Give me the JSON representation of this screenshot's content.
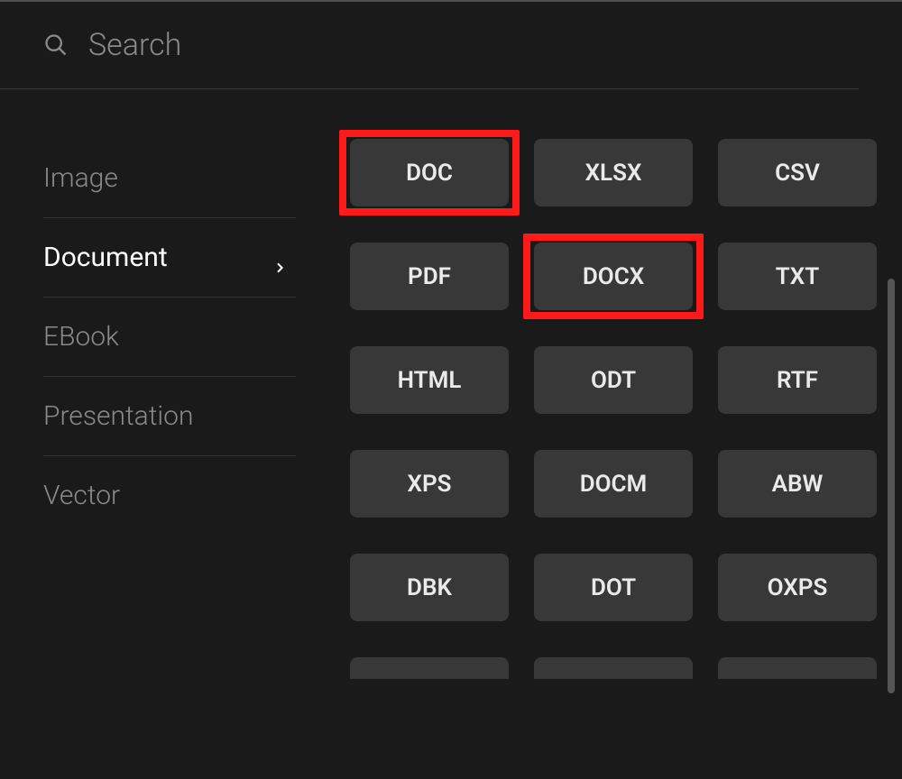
{
  "search": {
    "placeholder": "Search"
  },
  "sidebar": {
    "items": [
      {
        "label": "Image",
        "active": false
      },
      {
        "label": "Document",
        "active": true
      },
      {
        "label": "EBook",
        "active": false
      },
      {
        "label": "Presentation",
        "active": false
      },
      {
        "label": "Vector",
        "active": false
      }
    ]
  },
  "formats": [
    {
      "label": "DOC",
      "highlighted": true,
      "partial": false
    },
    {
      "label": "XLSX",
      "highlighted": false,
      "partial": false
    },
    {
      "label": "CSV",
      "highlighted": false,
      "partial": false
    },
    {
      "label": "PDF",
      "highlighted": false,
      "partial": false
    },
    {
      "label": "DOCX",
      "highlighted": true,
      "partial": false
    },
    {
      "label": "TXT",
      "highlighted": false,
      "partial": false
    },
    {
      "label": "HTML",
      "highlighted": false,
      "partial": false
    },
    {
      "label": "ODT",
      "highlighted": false,
      "partial": false
    },
    {
      "label": "RTF",
      "highlighted": false,
      "partial": false
    },
    {
      "label": "XPS",
      "highlighted": false,
      "partial": false
    },
    {
      "label": "DOCM",
      "highlighted": false,
      "partial": false
    },
    {
      "label": "ABW",
      "highlighted": false,
      "partial": false
    },
    {
      "label": "DBK",
      "highlighted": false,
      "partial": false
    },
    {
      "label": "DOT",
      "highlighted": false,
      "partial": false
    },
    {
      "label": "OXPS",
      "highlighted": false,
      "partial": false
    },
    {
      "label": "",
      "highlighted": false,
      "partial": true
    },
    {
      "label": "",
      "highlighted": false,
      "partial": true
    },
    {
      "label": "",
      "highlighted": false,
      "partial": true
    }
  ]
}
